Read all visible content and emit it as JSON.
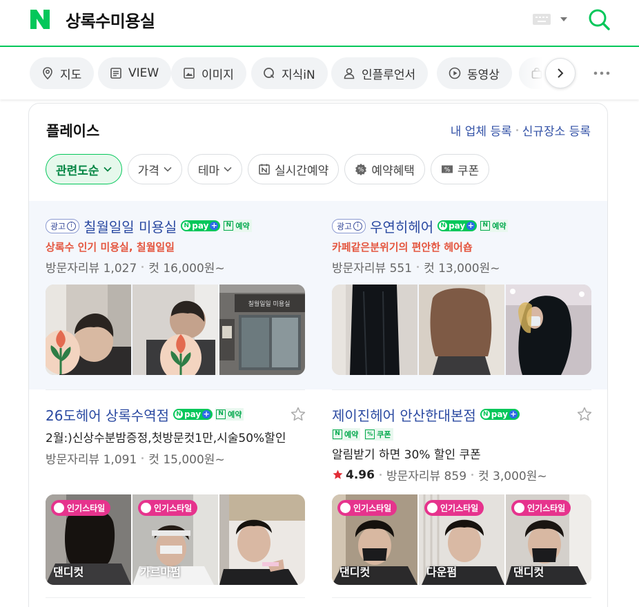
{
  "header": {
    "query": "상록수미용실",
    "logo": "naver-n-logo",
    "brand_color": "#03c75a"
  },
  "tabs": [
    {
      "label": "지도",
      "icon": "map-pin-icon"
    },
    {
      "label": "VIEW",
      "icon": "document-icon"
    },
    {
      "label": "이미지",
      "icon": "image-icon"
    },
    {
      "label": "지식iN",
      "icon": "q-icon"
    },
    {
      "label": "인플루언서",
      "icon": "person-icon"
    },
    {
      "label": "동영상",
      "icon": "play-icon"
    },
    {
      "label": "",
      "icon": "shopping-bag-icon"
    }
  ],
  "place": {
    "title": "플레이스",
    "link_register": "내 업체 등록",
    "link_new": "신규장소 등록",
    "filters": [
      {
        "label": "관련도순",
        "icon": "",
        "caret": true,
        "active": true
      },
      {
        "label": "가격",
        "icon": "",
        "caret": true,
        "active": false
      },
      {
        "label": "테마",
        "icon": "",
        "caret": true,
        "active": false
      },
      {
        "label": "실시간예약",
        "icon": "calendar-n-icon",
        "caret": false,
        "active": false
      },
      {
        "label": "예약혜택",
        "icon": "percent-badge-icon",
        "caret": false,
        "active": false
      },
      {
        "label": "쿠폰",
        "icon": "coupon-icon",
        "caret": false,
        "active": false
      }
    ],
    "ad_label": "광고",
    "npay_label": "pay",
    "booking_label": "예약",
    "coupon_label": "쿠폰",
    "popular_label": "인기스타일",
    "items": [
      {
        "name": "칠월일일 미용실",
        "promo": "상록수 인기 미용실, 칠월일일",
        "reviews": "방문자리뷰 1,027",
        "price": "컷 16,000원~"
      },
      {
        "name": "우연히헤어",
        "promo": "카페같은분위기의 편안한 헤어숍",
        "reviews": "방문자리뷰 551",
        "price": "컷 13,000원~"
      },
      {
        "name": "26도헤어 상록수역점",
        "desc": "2월:)신상수분밤증정,첫방문컷1만,시술50%할인",
        "reviews": "방문자리뷰 1,091",
        "price": "컷 15,000원~",
        "photo_captions": [
          "댄디컷",
          "가르마펌",
          ""
        ]
      },
      {
        "name": "제이진헤어 안산한대본점",
        "desc": "알림받기 하면 30% 할인 쿠폰",
        "rating": "4.96",
        "reviews": "방문자리뷰 859",
        "price": "컷 3,000원~",
        "photo_captions": [
          "댄디컷",
          "다운펌",
          "댄디컷"
        ]
      }
    ]
  }
}
